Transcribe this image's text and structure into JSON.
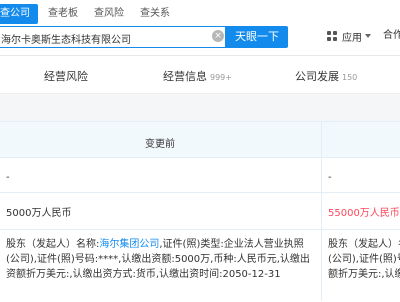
{
  "header": {
    "tabs": [
      "查公司",
      "查老板",
      "查风险",
      "查关系"
    ],
    "search": {
      "value": "海尔卡奥斯生态科技有限公司",
      "button": "天眼一下"
    },
    "app_label": "应用",
    "partner_label": "合作"
  },
  "subnav": {
    "items": [
      {
        "label": "经营风险",
        "count": ""
      },
      {
        "label": "经营信息",
        "count": "999+"
      },
      {
        "label": "公司发展",
        "count": "150"
      }
    ]
  },
  "table": {
    "header_before": "变更前",
    "rows": [
      {
        "before": "-",
        "after": "-"
      },
      {
        "before": "5000万人民币",
        "after": "55000万人民币"
      },
      {
        "before_prefix": "股东（发起人）名称:",
        "before_link": "海尔集团公司",
        "before_rest": ",证件(照)类型:企业法人营业执照(公司),证件(照)号码:****,认缴出资额:5000万,币种:人民币元,认缴出资额折万美元:,认缴出资方式:货币,认缴出资时间:2050-12-31",
        "after_line1": "股东（发起人）名",
        "after_line2": "(公司),证件(照)号",
        "after_line3": "额折万美元:,认缴"
      }
    ]
  },
  "colors": {
    "brand": "#128bed",
    "highlight": "#fd485e"
  }
}
